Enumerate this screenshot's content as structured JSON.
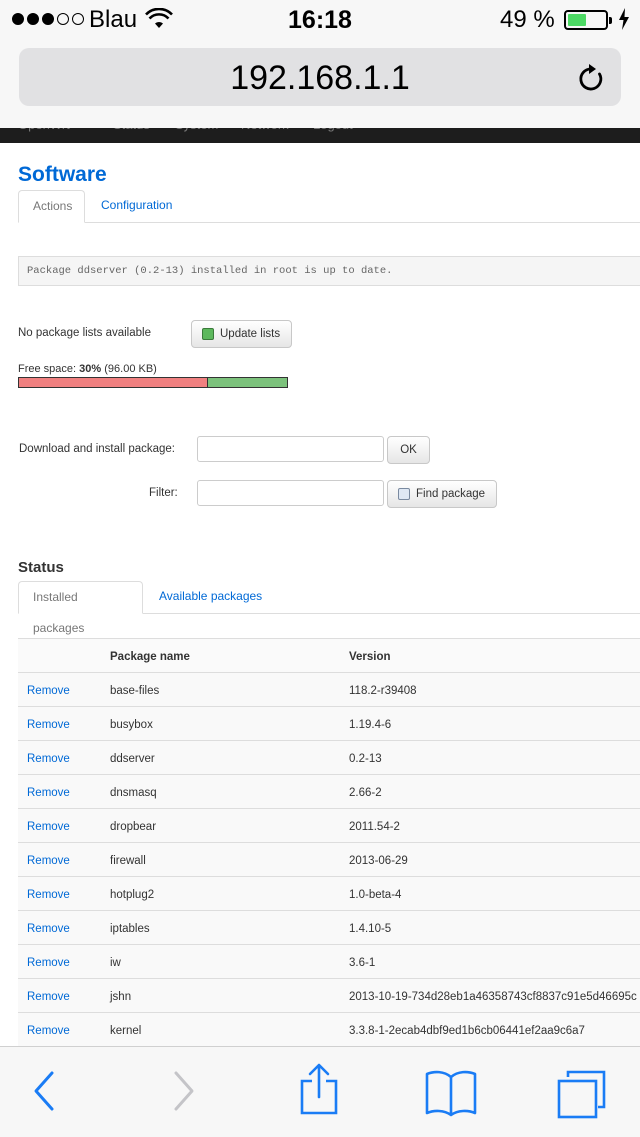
{
  "status_bar": {
    "carrier": "Blau",
    "time": "16:18",
    "battery_percent": "49 %",
    "battery_level": 0.49
  },
  "browser": {
    "url": "192.168.1.1"
  },
  "colors": {
    "link": "#0069d6",
    "used_space": "#f08080",
    "free_space": "#7cc27c",
    "battery": "#4cd964"
  },
  "software": {
    "title": "Software",
    "tabs": [
      {
        "label": "Actions",
        "active": true
      },
      {
        "label": "Configuration",
        "active": false
      }
    ],
    "message": "Package ddserver (0.2-13) installed in root is up to date.",
    "no_lists_label": "No package lists available",
    "update_button": "Update lists",
    "free_space_label": "Free space:",
    "free_space_value": "30%",
    "free_space_size": "(96.00 KB)",
    "used_fraction": 0.7,
    "download_label": "Download and install package:",
    "download_value": "",
    "ok_button": "OK",
    "filter_label": "Filter:",
    "filter_value": "",
    "find_button": "Find package"
  },
  "status": {
    "title": "Status",
    "tabs": [
      {
        "label": "Installed packages",
        "active": true
      },
      {
        "label": "Available packages",
        "active": false
      }
    ],
    "columns": [
      "Package name",
      "Version"
    ],
    "action_label": "Remove",
    "rows": [
      {
        "name": "base-files",
        "version": "118.2-r39408"
      },
      {
        "name": "busybox",
        "version": "1.19.4-6"
      },
      {
        "name": "ddserver",
        "version": "0.2-13"
      },
      {
        "name": "dnsmasq",
        "version": "2.66-2"
      },
      {
        "name": "dropbear",
        "version": "2011.54-2"
      },
      {
        "name": "firewall",
        "version": "2013-06-29"
      },
      {
        "name": "hotplug2",
        "version": "1.0-beta-4"
      },
      {
        "name": "iptables",
        "version": "1.4.10-5"
      },
      {
        "name": "iw",
        "version": "3.6-1"
      },
      {
        "name": "jshn",
        "version": "2013-10-19-734d28eb1a46358743cf8837c91e5d46695c"
      },
      {
        "name": "kernel",
        "version": "3.3.8-1-2ecab4dbf9ed1b6cb06441ef2aa9c6a7"
      }
    ]
  }
}
